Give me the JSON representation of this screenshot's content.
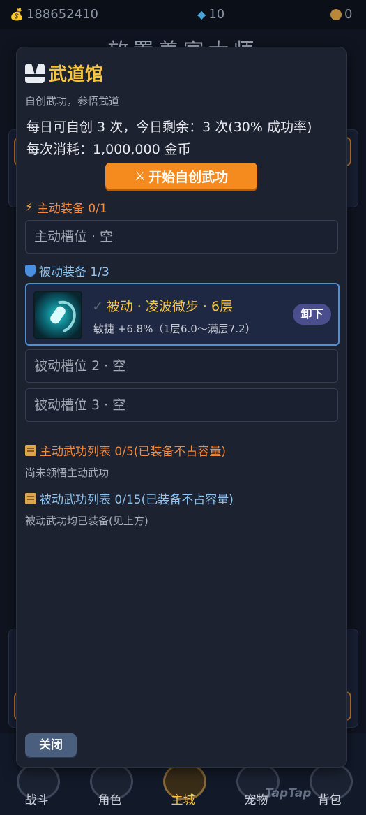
{
  "topbar": {
    "gold_icon": "money-bag-icon",
    "gold": "188652410",
    "diamonds": "10",
    "coins": "0"
  },
  "background_title": "放置养家大师",
  "bottom_nav": [
    {
      "label": "战斗"
    },
    {
      "label": "角色"
    },
    {
      "label": "主城"
    },
    {
      "label": "宠物"
    },
    {
      "label": "背包"
    }
  ],
  "watermark": "TapTap",
  "modal": {
    "title": "武道馆",
    "subtitle": "自创武功，参悟武道",
    "daily_info": "每日可自创 3 次，今日剩余：3 次(30% 成功率)",
    "cost_info": "每次消耗：1,000,000 金币",
    "create_button": "开始自创武功",
    "active_section": {
      "title": "主动装备 0/1",
      "slot": "主动槽位 · 空"
    },
    "passive_section": {
      "title": "被动装备 1/3",
      "equipped": {
        "name": "被动 · 凌波微步 · 6层",
        "desc": "敏捷 +6.8%（1层6.0～满层7.2）",
        "unequip": "卸下"
      },
      "slot2": "被动槽位 2 · 空",
      "slot3": "被动槽位 3 · 空"
    },
    "active_list": {
      "title": "主动武功列表 0/5(已装备不占容量)",
      "note": "尚未领悟主动武功"
    },
    "passive_list": {
      "title": "被动武功列表 0/15(已装备不占容量)",
      "note": "被动武功均已装备(见上方)"
    },
    "close_button": "关闭"
  },
  "colors": {
    "accent_orange": "#f58a1f",
    "title_gold": "#f5c542",
    "passive_blue": "#4e8fd6",
    "modal_bg": "#1d2231"
  }
}
